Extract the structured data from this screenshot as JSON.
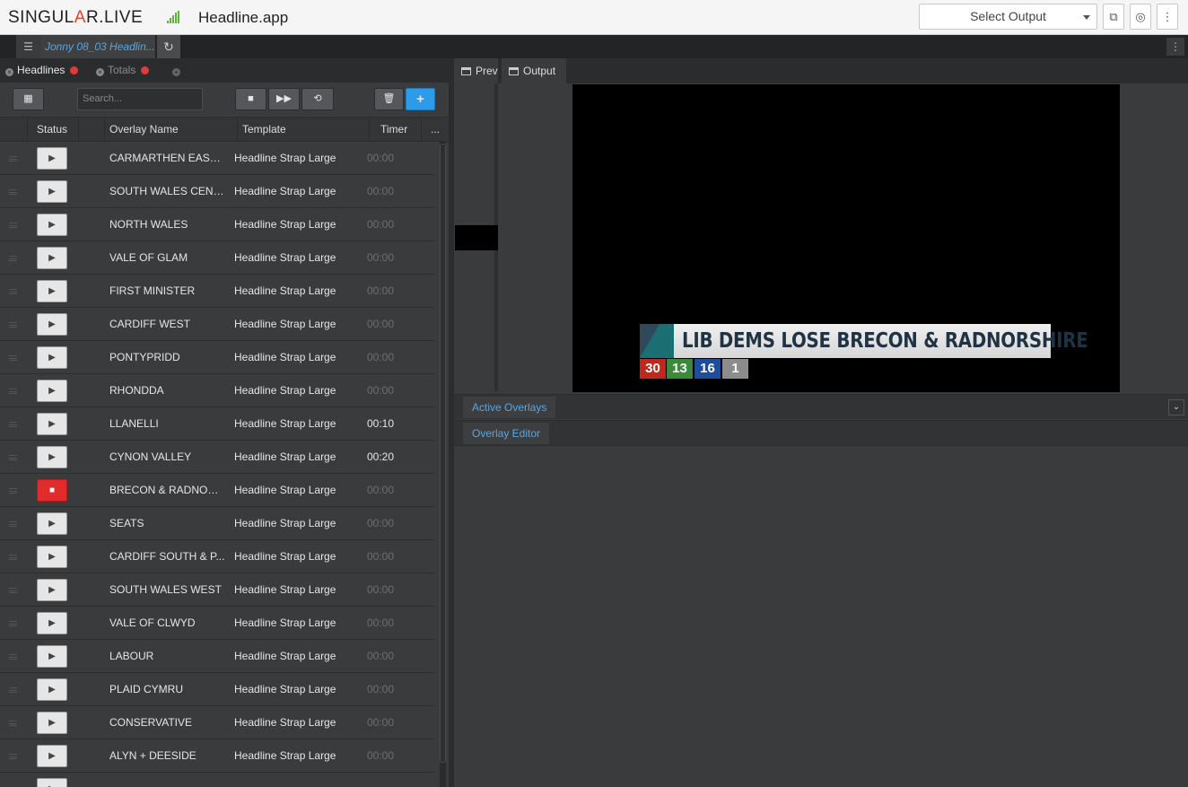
{
  "app": {
    "brand_prefix": "SINGUL",
    "brand_accent": "A",
    "brand_suffix": "R.LIVE",
    "title": "Headline.app"
  },
  "header": {
    "select_output": "Select Output"
  },
  "docbar": {
    "doc_tab": "Jonny 08_03 Headlin..."
  },
  "list_tabs": [
    {
      "label": "Headlines"
    },
    {
      "label": "Totals"
    }
  ],
  "toolbar": {
    "search_placeholder": "Search...",
    "add_label": "+"
  },
  "table": {
    "columns": {
      "status": "Status",
      "name": "Overlay Name",
      "template": "Template",
      "timer": "Timer",
      "more": "..."
    },
    "rows": [
      {
        "name": "CARMARTHEN EAST ...",
        "template": "Headline Strap Large",
        "timer": "00:00",
        "active": false,
        "timer_set": false
      },
      {
        "name": "SOUTH WALES CENT...",
        "template": "Headline Strap Large",
        "timer": "00:00",
        "active": false,
        "timer_set": false
      },
      {
        "name": "NORTH WALES",
        "template": "Headline Strap Large",
        "timer": "00:00",
        "active": false,
        "timer_set": false
      },
      {
        "name": "VALE OF GLAM",
        "template": "Headline Strap Large",
        "timer": "00:00",
        "active": false,
        "timer_set": false
      },
      {
        "name": "FIRST MINISTER",
        "template": "Headline Strap Large",
        "timer": "00:00",
        "active": false,
        "timer_set": false
      },
      {
        "name": "CARDIFF WEST",
        "template": "Headline Strap Large",
        "timer": "00:00",
        "active": false,
        "timer_set": false
      },
      {
        "name": "PONTYPRIDD",
        "template": "Headline Strap Large",
        "timer": "00:00",
        "active": false,
        "timer_set": false
      },
      {
        "name": "RHONDDA",
        "template": "Headline Strap Large",
        "timer": "00:00",
        "active": false,
        "timer_set": false
      },
      {
        "name": "LLANELLI",
        "template": "Headline Strap Large",
        "timer": "00:10",
        "active": false,
        "timer_set": true
      },
      {
        "name": "CYNON VALLEY",
        "template": "Headline Strap Large",
        "timer": "00:20",
        "active": false,
        "timer_set": true
      },
      {
        "name": "BRECON & RADNORS...",
        "template": "Headline Strap Large",
        "timer": "00:00",
        "active": true,
        "timer_set": false
      },
      {
        "name": "SEATS",
        "template": "Headline Strap Large",
        "timer": "00:00",
        "active": false,
        "timer_set": false
      },
      {
        "name": "CARDIFF SOUTH & P...",
        "template": "Headline Strap Large",
        "timer": "00:00",
        "active": false,
        "timer_set": false
      },
      {
        "name": "SOUTH WALES WEST",
        "template": "Headline Strap Large",
        "timer": "00:00",
        "active": false,
        "timer_set": false
      },
      {
        "name": "VALE OF CLWYD",
        "template": "Headline Strap Large",
        "timer": "00:00",
        "active": false,
        "timer_set": false
      },
      {
        "name": "LABOUR",
        "template": "Headline Strap Large",
        "timer": "00:00",
        "active": false,
        "timer_set": false
      },
      {
        "name": "PLAID CYMRU",
        "template": "Headline Strap Large",
        "timer": "00:00",
        "active": false,
        "timer_set": false
      },
      {
        "name": "CONSERVATIVE",
        "template": "Headline Strap Large",
        "timer": "00:00",
        "active": false,
        "timer_set": false
      },
      {
        "name": "ALYN + DEESIDE",
        "template": "Headline Strap Large",
        "timer": "00:00",
        "active": false,
        "timer_set": false
      }
    ]
  },
  "preview_tabs": {
    "preview": "Prev",
    "output": "Output"
  },
  "strap": {
    "headline": "LIB DEMS LOSE BRECON & RADNORSHIRE",
    "numbers": [
      {
        "value": "30",
        "color": "#c0281e"
      },
      {
        "value": "13",
        "color": "#3a8a3a"
      },
      {
        "value": "16",
        "color": "#1e4d9a"
      },
      {
        "value": "1",
        "color": "#8c8c8c"
      }
    ]
  },
  "panels": {
    "active_overlays": "Active Overlays",
    "overlay_editor": "Overlay Editor"
  },
  "colors": {
    "accent": "#57a6e6",
    "add_button": "#2d9be8",
    "live": "#e22c2c"
  }
}
